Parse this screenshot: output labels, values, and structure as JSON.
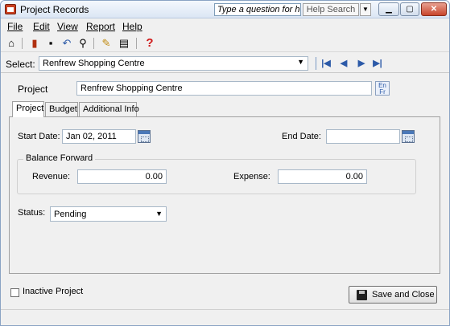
{
  "window": {
    "title": "Project Records",
    "help_placeholder": "Type a question for help",
    "help_search": "Help Search"
  },
  "menu": [
    "File",
    "Edit",
    "View",
    "Report",
    "Help"
  ],
  "toolbar_icons": [
    "home-icon",
    "delete-icon",
    "save-icon",
    "undo-icon",
    "find-icon",
    "edit-icon",
    "notes-icon",
    "help-icon"
  ],
  "select": {
    "label": "Select:",
    "value": "Renfrew Shopping Centre"
  },
  "project": {
    "label": "Project",
    "value": "Renfrew Shopping Centre",
    "lang_icon": "EnFr"
  },
  "tabs": [
    "Project",
    "Budget",
    "Additional Info"
  ],
  "form": {
    "start_date_label": "Start Date:",
    "start_date": "Jan 02, 2011",
    "end_date_label": "End Date:",
    "end_date": "",
    "balance_forward_label": "Balance Forward",
    "revenue_label": "Revenue:",
    "revenue": "0.00",
    "expense_label": "Expense:",
    "expense": "0.00",
    "status_label": "Status:",
    "status": "Pending"
  },
  "footer": {
    "inactive_label": "Inactive Project",
    "save_close_label": "Save and Close"
  },
  "colors": {
    "nav_accent": "#2c5aa8",
    "help_icon_red": "#d01818"
  }
}
